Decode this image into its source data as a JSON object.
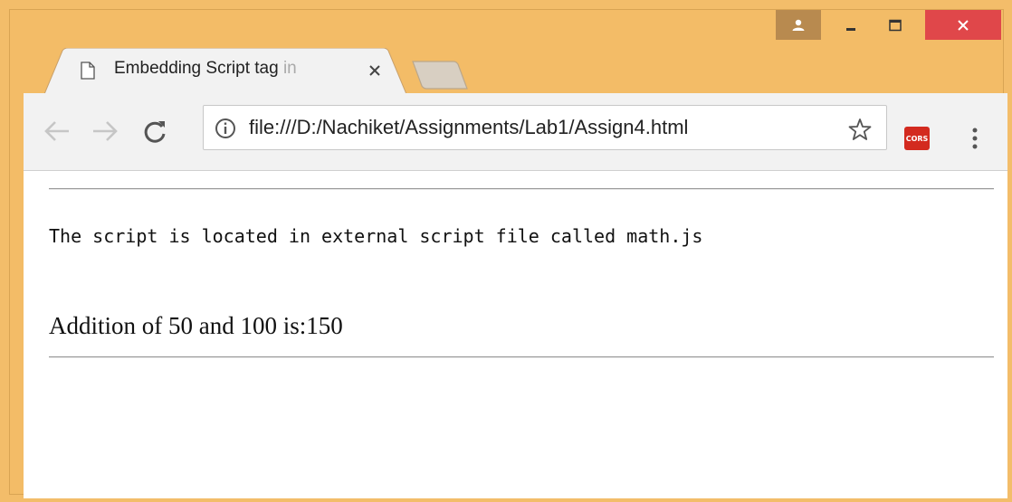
{
  "browser": {
    "tab": {
      "title_main": "Embedding Script tag ",
      "title_fade": "in"
    },
    "address": {
      "url": "file:///D:/Nachiket/Assignments/Lab1/Assign4.html"
    },
    "extension": {
      "label": "CORS",
      "color": "#d32a1f"
    },
    "icons": {
      "profile": "profile-icon",
      "minimize": "minimize-icon",
      "maximize": "maximize-icon",
      "close": "close-icon",
      "favicon": "page-icon",
      "tab_close": "tab-close-icon",
      "back": "back-arrow-icon",
      "forward": "forward-arrow-icon",
      "reload": "reload-icon",
      "info": "info-icon",
      "bookmark": "star-icon",
      "menu": "kebab-menu-icon"
    },
    "colors": {
      "frame": "#f3bc67",
      "close_button": "#e0474a"
    }
  },
  "page": {
    "script_note": "The script is located in external script file called math.js",
    "result": "Addition of 50 and 100 is:150"
  }
}
